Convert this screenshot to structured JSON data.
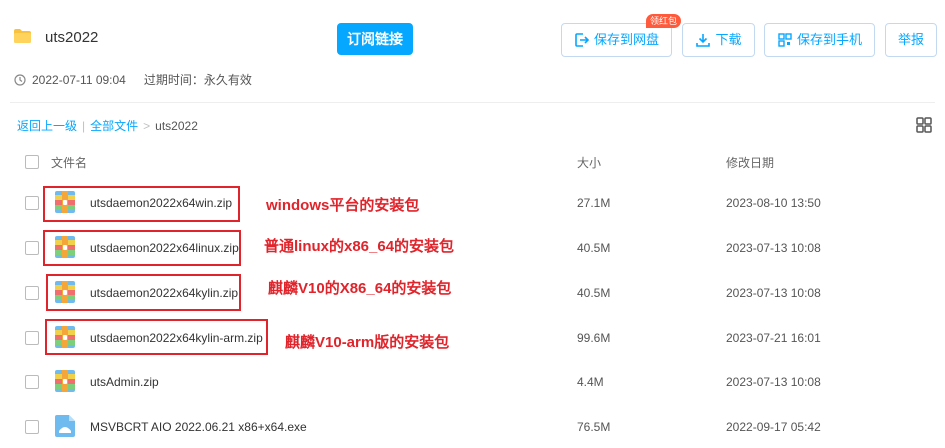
{
  "header": {
    "title": "uts2022",
    "subscribe_label": "订阅链接",
    "save_label": "保存到网盘",
    "red_packet_badge": "领红包",
    "download_label": "下载",
    "save_phone_label": "保存到手机",
    "report_label": "举报"
  },
  "meta": {
    "date": "2022-07-11 09:04",
    "expire": "过期时间：永久有效"
  },
  "breadcrumb": {
    "back": "返回上一级",
    "sep": "|",
    "all": "全部文件",
    "arrow": ">",
    "current": "uts2022"
  },
  "columns": {
    "name": "文件名",
    "size": "大小",
    "date": "修改日期"
  },
  "files": [
    {
      "name": "utsdaemon2022x64win.zip",
      "size": "27.1M",
      "date": "2023-08-10 13:50",
      "annotation": "windows平台的安装包"
    },
    {
      "name": "utsdaemon2022x64linux.zip",
      "size": "40.5M",
      "date": "2023-07-13 10:08",
      "annotation": "普通linux的x86_64的安装包"
    },
    {
      "name": "utsdaemon2022x64kylin.zip",
      "size": "40.5M",
      "date": "2023-07-13 10:08",
      "annotation": "麒麟V10的X86_64的安装包"
    },
    {
      "name": "utsdaemon2022x64kylin-arm.zip",
      "size": "99.6M",
      "date": "2023-07-21 16:01",
      "annotation": "麒麟V10-arm版的安装包"
    },
    {
      "name": "utsAdmin.zip",
      "size": "4.4M",
      "date": "2023-07-13 10:08"
    },
    {
      "name": "MSVBCRT AIO 2022.06.21 x86+x64.exe",
      "size": "76.5M",
      "date": "2022-09-17 05:42"
    }
  ],
  "colors": {
    "accent": "#06a7ff",
    "annotation": "#e0242b"
  },
  "icons": {
    "folder": "folder-icon",
    "clock": "clock-icon",
    "grid": "grid-view-icon",
    "zip": "zip-file-icon",
    "exe": "exe-file-icon"
  }
}
